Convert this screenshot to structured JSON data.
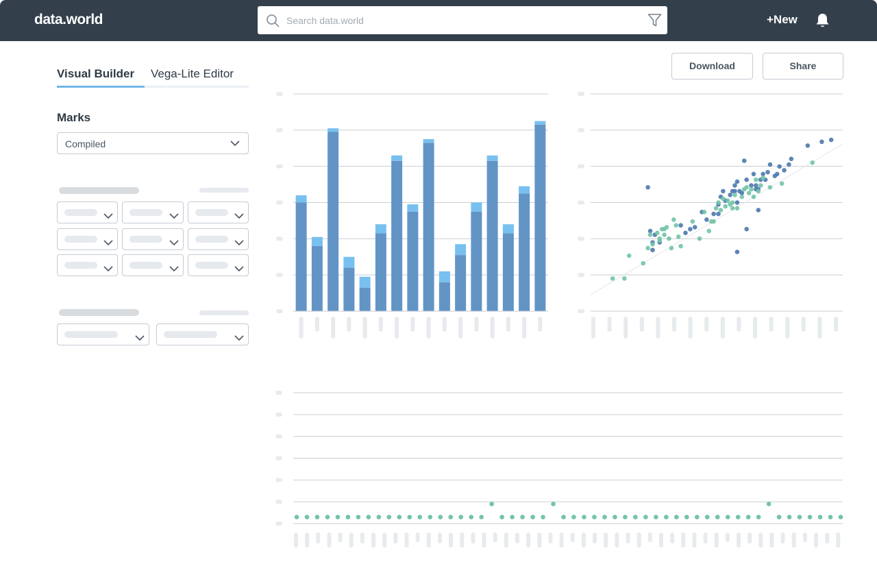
{
  "topbar": {
    "logo": "data.world",
    "search_placeholder": "Search data.world",
    "new_label": "+New"
  },
  "tabs": [
    {
      "label": "Visual Builder",
      "active": true
    },
    {
      "label": "Vega-Lite Editor",
      "active": false
    }
  ],
  "marks": {
    "title": "Marks",
    "selected": "Compiled"
  },
  "actions": {
    "download_label": "Download",
    "share_label": "Share"
  },
  "colors": {
    "bar_main": "#6394c6",
    "bar_top": "#78c0ef",
    "dot_blue": "#4c79ad",
    "dot_green": "#72c4a6",
    "grid": "#c9ced3",
    "placeholder": "#e8ebee"
  },
  "chart_data": [
    {
      "type": "bar",
      "stacked": true,
      "series": [
        {
          "values": [
            60,
            36,
            99,
            24,
            13,
            43,
            83,
            55,
            93,
            16,
            31,
            55,
            83,
            43,
            65,
            103
          ]
        },
        {
          "values": [
            4,
            5,
            2,
            6,
            6,
            5,
            3,
            4,
            2,
            6,
            6,
            5,
            3,
            5,
            4,
            2
          ]
        }
      ],
      "ylim": [
        0,
        120
      ],
      "grid": true
    },
    {
      "type": "scatter",
      "xlim": [
        0,
        100
      ],
      "ylim": [
        0,
        100
      ],
      "grid": true,
      "series": [
        {
          "points": [
            [
              20,
              58
            ],
            [
              21,
              35
            ],
            [
              22,
              25
            ],
            [
              22,
              29
            ],
            [
              23,
              33
            ],
            [
              25,
              29
            ],
            [
              34,
              38
            ],
            [
              36,
              34
            ],
            [
              38,
              36
            ],
            [
              40,
              37
            ],
            [
              43,
              45
            ],
            [
              45,
              41
            ],
            [
              48,
              44
            ],
            [
              50,
              44
            ],
            [
              50,
              49
            ],
            [
              51,
              53
            ],
            [
              52,
              56
            ],
            [
              53,
              51
            ],
            [
              55,
              54
            ],
            [
              56,
              56
            ],
            [
              57,
              59
            ],
            [
              57,
              56
            ],
            [
              58,
              61
            ],
            [
              58,
              50
            ],
            [
              59,
              56
            ],
            [
              60,
              55
            ],
            [
              62,
              62
            ],
            [
              64,
              59
            ],
            [
              65,
              65
            ],
            [
              66,
              57
            ],
            [
              66,
              59
            ],
            [
              67,
              57
            ],
            [
              68,
              62
            ],
            [
              69,
              65
            ],
            [
              70,
              62
            ],
            [
              71,
              66
            ],
            [
              72,
              70
            ],
            [
              74,
              64
            ],
            [
              75,
              65
            ],
            [
              76,
              69
            ],
            [
              78,
              67
            ],
            [
              80,
              70
            ],
            [
              81,
              73
            ],
            [
              88,
              80
            ],
            [
              94,
              82
            ],
            [
              98,
              83
            ],
            [
              61,
              72
            ],
            [
              58,
              24
            ],
            [
              62,
              36
            ],
            [
              67,
              46
            ]
          ]
        },
        {
          "points": [
            [
              5,
              10
            ],
            [
              10,
              10
            ],
            [
              12,
              22
            ],
            [
              18,
              18
            ],
            [
              20,
              26
            ],
            [
              21,
              33
            ],
            [
              22,
              28
            ],
            [
              24,
              34
            ],
            [
              25,
              31
            ],
            [
              26,
              36
            ],
            [
              27,
              33
            ],
            [
              28,
              37
            ],
            [
              29,
              31
            ],
            [
              30,
              26
            ],
            [
              31,
              41
            ],
            [
              32,
              38
            ],
            [
              33,
              32
            ],
            [
              34,
              27
            ],
            [
              39,
              40
            ],
            [
              42,
              31
            ],
            [
              44,
              45
            ],
            [
              46,
              35
            ],
            [
              47,
              40
            ],
            [
              48,
              40
            ],
            [
              49,
              47
            ],
            [
              50,
              50
            ],
            [
              51,
              46
            ],
            [
              52,
              52
            ],
            [
              53,
              48
            ],
            [
              54,
              51
            ],
            [
              55,
              49
            ],
            [
              56,
              50
            ],
            [
              56,
              47
            ],
            [
              57,
              54
            ],
            [
              58,
              47
            ],
            [
              60,
              53
            ],
            [
              61,
              57
            ],
            [
              62,
              58
            ],
            [
              63,
              55
            ],
            [
              64,
              57
            ],
            [
              65,
              53
            ],
            [
              66,
              62
            ],
            [
              67,
              56
            ],
            [
              68,
              59
            ],
            [
              69,
              63
            ],
            [
              72,
              58
            ],
            [
              77,
              60
            ],
            [
              90,
              71
            ],
            [
              25,
              30
            ],
            [
              27,
              36
            ]
          ]
        }
      ]
    },
    {
      "type": "scatter",
      "xlim": [
        1,
        54
      ],
      "ylim": [
        0,
        100
      ],
      "grid": true,
      "series": [
        {
          "points": [
            [
              1,
              5
            ],
            [
              2,
              5
            ],
            [
              3,
              5
            ],
            [
              4,
              5
            ],
            [
              5,
              5
            ],
            [
              6,
              5
            ],
            [
              7,
              5
            ],
            [
              8,
              5
            ],
            [
              9,
              5
            ],
            [
              10,
              5
            ],
            [
              11,
              5
            ],
            [
              12,
              5
            ],
            [
              13,
              5
            ],
            [
              14,
              5
            ],
            [
              15,
              5
            ],
            [
              16,
              5
            ],
            [
              17,
              5
            ],
            [
              18,
              5
            ],
            [
              19,
              5
            ],
            [
              20,
              15
            ],
            [
              21,
              5
            ],
            [
              22,
              5
            ],
            [
              23,
              5
            ],
            [
              24,
              5
            ],
            [
              25,
              5
            ],
            [
              26,
              15
            ],
            [
              27,
              5
            ],
            [
              28,
              5
            ],
            [
              29,
              5
            ],
            [
              30,
              5
            ],
            [
              31,
              5
            ],
            [
              32,
              5
            ],
            [
              33,
              5
            ],
            [
              34,
              5
            ],
            [
              35,
              5
            ],
            [
              36,
              5
            ],
            [
              37,
              5
            ],
            [
              38,
              5
            ],
            [
              39,
              5
            ],
            [
              40,
              5
            ],
            [
              41,
              5
            ],
            [
              42,
              5
            ],
            [
              43,
              5
            ],
            [
              44,
              5
            ],
            [
              45,
              5
            ],
            [
              46,
              5
            ],
            [
              47,
              15
            ],
            [
              48,
              5
            ],
            [
              49,
              5
            ],
            [
              50,
              5
            ],
            [
              51,
              5
            ],
            [
              52,
              5
            ],
            [
              53,
              5
            ],
            [
              54,
              5
            ]
          ]
        }
      ]
    }
  ]
}
